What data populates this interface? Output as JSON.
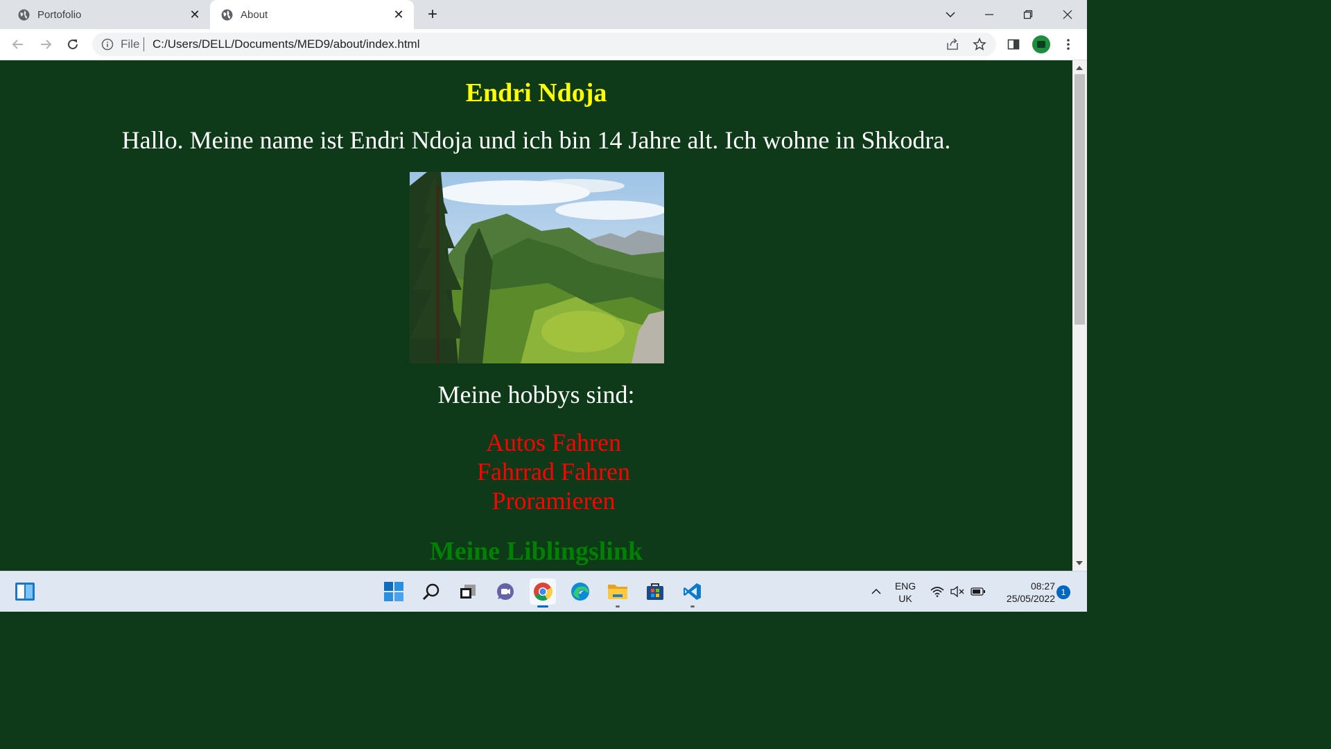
{
  "browser": {
    "tabs": [
      {
        "label": "Portofolio",
        "active": false
      },
      {
        "label": "About",
        "active": true
      }
    ],
    "address": {
      "scheme_label": "File",
      "url": "C:/Users/DELL/Documents/MED9/about/index.html"
    }
  },
  "page": {
    "title": "Endri Ndoja",
    "intro": "Hallo. Meine name ist Endri Ndoja und ich bin 14 Jahre alt. Ich wohne in Shkodra.",
    "hobbies_title": "Meine hobbys sind:",
    "hobbies": [
      "Autos Fahren",
      "Fahrrad Fahren",
      "Proramieren"
    ],
    "links_title": "Meine Liblingslink",
    "colors": {
      "background": "#0e3a1a",
      "title": "#ffff00",
      "hobbies": "#ff0000",
      "links_title": "#008000"
    }
  },
  "taskbar": {
    "apps": [
      "start-icon",
      "search-icon",
      "task-view-icon",
      "chat-icon",
      "chrome-icon",
      "edge-icon",
      "file-explorer-icon",
      "store-icon",
      "vscode-icon"
    ],
    "language": {
      "line1": "ENG",
      "line2": "UK"
    },
    "clock": {
      "time": "08:27",
      "date": "25/05/2022"
    },
    "notification_count": "1"
  }
}
